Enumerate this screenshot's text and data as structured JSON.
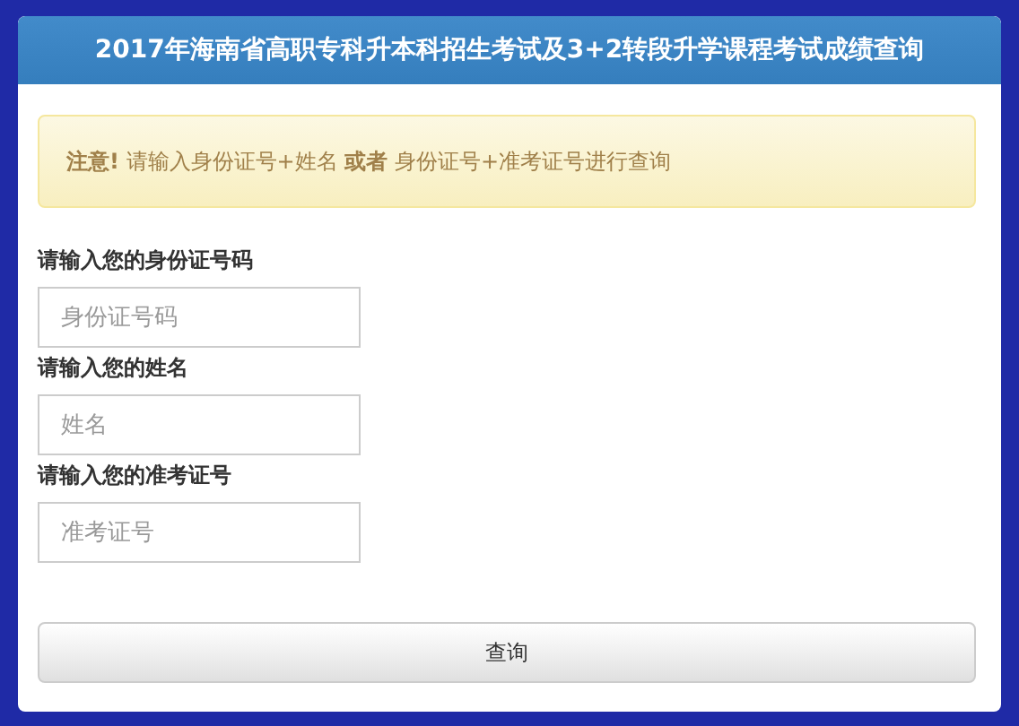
{
  "panel": {
    "title": "2017年海南省高职专科升本科招生考试及3+2转段升学课程考试成绩查询"
  },
  "alert": {
    "text": "**注意!** 请输入身份证号+姓名 **或者** 身份证号+准考证号进行查询"
  },
  "fields": [
    {
      "label": "请输入您的身份证号码",
      "placeholder": "身份证号码"
    },
    {
      "label": "请输入您的姓名",
      "placeholder": "姓名"
    },
    {
      "label": "请输入您的准考证号",
      "placeholder": "准考证号"
    }
  ],
  "submit": {
    "label": "查询"
  }
}
